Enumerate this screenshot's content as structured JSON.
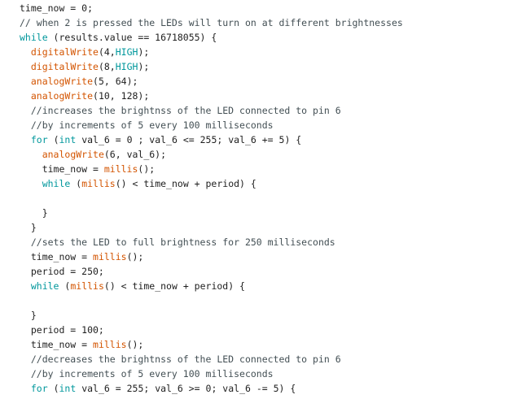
{
  "colors": {
    "plain": "#1e1e1e",
    "comment": "#434f54",
    "keyword": "#00979c",
    "function": "#d35400",
    "constant": "#00979c",
    "background": "#ffffff"
  },
  "code_lines": [
    [
      {
        "t": "time_now = 0;",
        "k": "txt"
      }
    ],
    [
      {
        "t": "// when 2 is pressed the LEDs will turn on at different brightnesses",
        "k": "cmt"
      }
    ],
    [
      {
        "t": "while",
        "k": "kw"
      },
      {
        "t": " (results.value == 16718055) {",
        "k": "txt"
      }
    ],
    [
      {
        "t": "  ",
        "k": "txt"
      },
      {
        "t": "digitalWrite",
        "k": "fn"
      },
      {
        "t": "(4,",
        "k": "txt"
      },
      {
        "t": "HIGH",
        "k": "const"
      },
      {
        "t": ");",
        "k": "txt"
      }
    ],
    [
      {
        "t": "  ",
        "k": "txt"
      },
      {
        "t": "digitalWrite",
        "k": "fn"
      },
      {
        "t": "(8,",
        "k": "txt"
      },
      {
        "t": "HIGH",
        "k": "const"
      },
      {
        "t": ");",
        "k": "txt"
      }
    ],
    [
      {
        "t": "  ",
        "k": "txt"
      },
      {
        "t": "analogWrite",
        "k": "fn"
      },
      {
        "t": "(5, 64);",
        "k": "txt"
      }
    ],
    [
      {
        "t": "  ",
        "k": "txt"
      },
      {
        "t": "analogWrite",
        "k": "fn"
      },
      {
        "t": "(10, 128);",
        "k": "txt"
      }
    ],
    [
      {
        "t": "  //increases the brightnss of the LED connected to pin 6",
        "k": "cmt"
      }
    ],
    [
      {
        "t": "  //by increments of 5 every 100 milliseconds",
        "k": "cmt"
      }
    ],
    [
      {
        "t": "  ",
        "k": "txt"
      },
      {
        "t": "for",
        "k": "kw"
      },
      {
        "t": " (",
        "k": "txt"
      },
      {
        "t": "int",
        "k": "kw"
      },
      {
        "t": " val_6 = 0 ; val_6 <= 255; val_6 += 5) {",
        "k": "txt"
      }
    ],
    [
      {
        "t": "    ",
        "k": "txt"
      },
      {
        "t": "analogWrite",
        "k": "fn"
      },
      {
        "t": "(6, val_6);",
        "k": "txt"
      }
    ],
    [
      {
        "t": "    time_now = ",
        "k": "txt"
      },
      {
        "t": "millis",
        "k": "fn"
      },
      {
        "t": "();",
        "k": "txt"
      }
    ],
    [
      {
        "t": "    ",
        "k": "txt"
      },
      {
        "t": "while",
        "k": "kw"
      },
      {
        "t": " (",
        "k": "txt"
      },
      {
        "t": "millis",
        "k": "fn"
      },
      {
        "t": "() < time_now + period) {",
        "k": "txt"
      }
    ],
    [
      {
        "t": "",
        "k": "txt"
      }
    ],
    [
      {
        "t": "    }",
        "k": "txt"
      }
    ],
    [
      {
        "t": "  }",
        "k": "txt"
      }
    ],
    [
      {
        "t": "  //sets the LED to full brightness for 250 milliseconds",
        "k": "cmt"
      }
    ],
    [
      {
        "t": "  time_now = ",
        "k": "txt"
      },
      {
        "t": "millis",
        "k": "fn"
      },
      {
        "t": "();",
        "k": "txt"
      }
    ],
    [
      {
        "t": "  period = 250;",
        "k": "txt"
      }
    ],
    [
      {
        "t": "  ",
        "k": "txt"
      },
      {
        "t": "while",
        "k": "kw"
      },
      {
        "t": " (",
        "k": "txt"
      },
      {
        "t": "millis",
        "k": "fn"
      },
      {
        "t": "() < time_now + period) {",
        "k": "txt"
      }
    ],
    [
      {
        "t": "",
        "k": "txt"
      }
    ],
    [
      {
        "t": "  }",
        "k": "txt"
      }
    ],
    [
      {
        "t": "  period = 100;",
        "k": "txt"
      }
    ],
    [
      {
        "t": "  time_now = ",
        "k": "txt"
      },
      {
        "t": "millis",
        "k": "fn"
      },
      {
        "t": "();",
        "k": "txt"
      }
    ],
    [
      {
        "t": "  //decreases the brightnss of the LED connected to pin 6",
        "k": "cmt"
      }
    ],
    [
      {
        "t": "  //by increments of 5 every 100 milliseconds",
        "k": "cmt"
      }
    ],
    [
      {
        "t": "  ",
        "k": "txt"
      },
      {
        "t": "for",
        "k": "kw"
      },
      {
        "t": " (",
        "k": "txt"
      },
      {
        "t": "int",
        "k": "kw"
      },
      {
        "t": " val_6 = 255; val_6 >= 0; val_6 -= 5) {",
        "k": "txt"
      }
    ]
  ]
}
